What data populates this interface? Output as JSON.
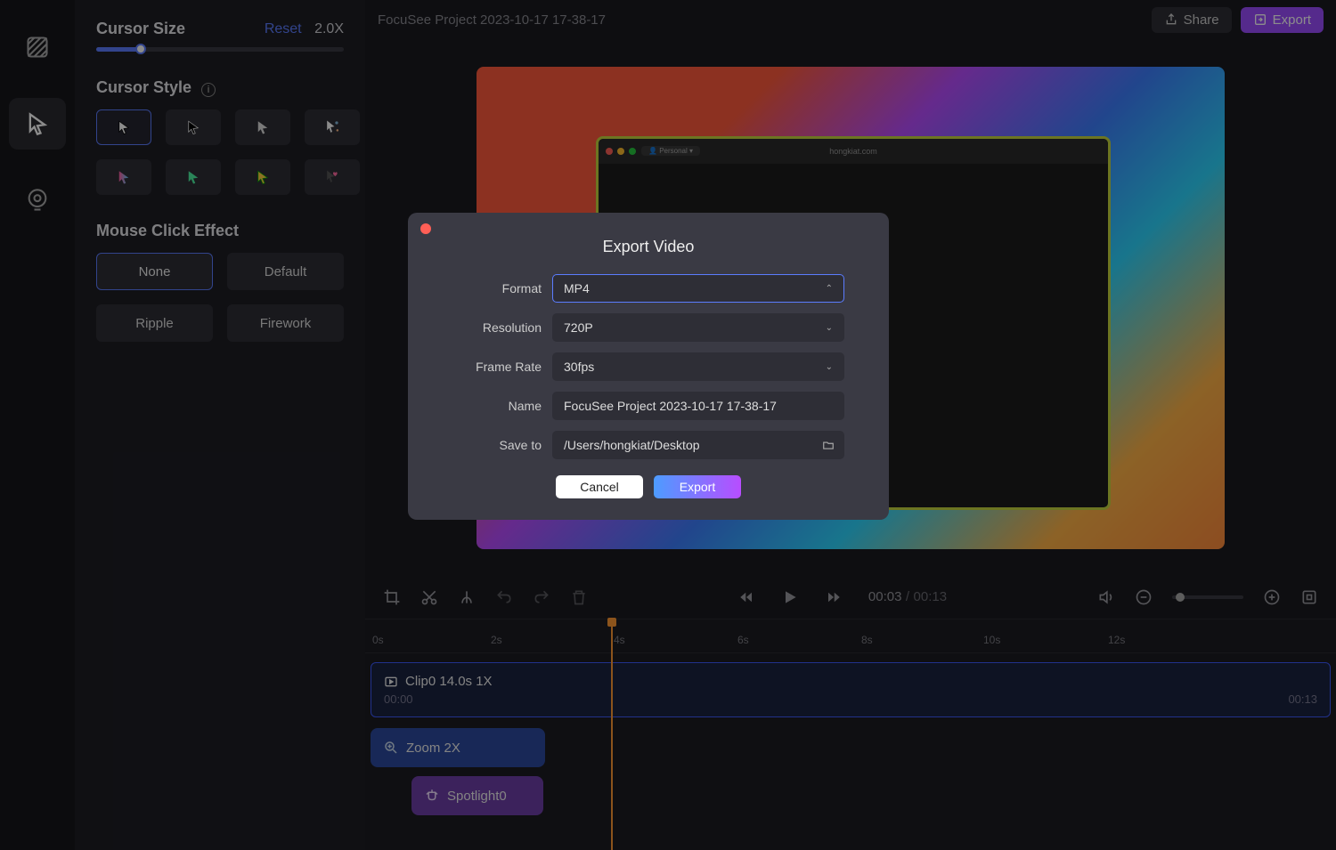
{
  "rail": {
    "items": [
      "texture",
      "cursor",
      "record"
    ]
  },
  "sidebar": {
    "size_title": "Cursor Size",
    "reset": "Reset",
    "size_value": "2.0X",
    "style_title": "Cursor Style",
    "click_title": "Mouse Click Effect",
    "effects": {
      "none": "None",
      "default": "Default",
      "ripple": "Ripple",
      "firework": "Firework"
    }
  },
  "topbar": {
    "project": "FocuSee Project 2023-10-17 17-38-17",
    "share": "Share",
    "export": "Export"
  },
  "preview": {
    "address": "hongkiat.com",
    "tab": "Personal"
  },
  "controls": {
    "current": "00:03",
    "sep": "/",
    "total": "00:13"
  },
  "timeline": {
    "marks": [
      "0s",
      "2s",
      "4s",
      "6s",
      "8s",
      "10s",
      "12s"
    ],
    "clip": {
      "title": "Clip0 14.0s 1X",
      "start": "00:00",
      "end": "00:13"
    },
    "zoom": "Zoom 2X",
    "spot": "Spotlight0"
  },
  "modal": {
    "title": "Export Video",
    "labels": {
      "format": "Format",
      "resolution": "Resolution",
      "framerate": "Frame Rate",
      "name": "Name",
      "saveto": "Save to"
    },
    "values": {
      "format": "MP4",
      "resolution": "720P",
      "framerate": "30fps",
      "name": "FocuSee Project 2023-10-17 17-38-17",
      "saveto": "/Users/hongkiat/Desktop"
    },
    "cancel": "Cancel",
    "export": "Export"
  }
}
